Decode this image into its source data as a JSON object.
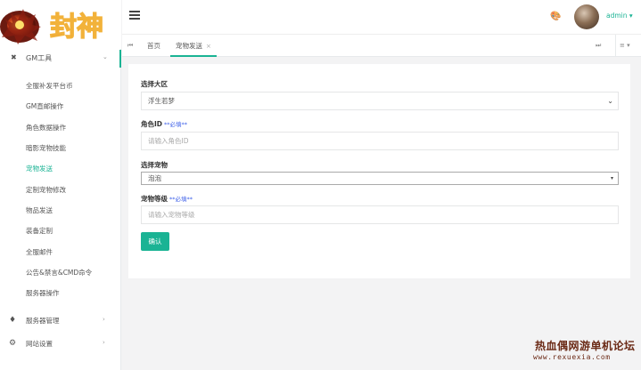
{
  "colors": {
    "accent": "#1ab394",
    "required": "#3b5ee8"
  },
  "logo": {
    "text": "封神"
  },
  "sidebar": {
    "group": {
      "label": "GM工具",
      "icon": "wrench-icon"
    },
    "items": [
      {
        "label": "全服补发平台币"
      },
      {
        "label": "GM直邮操作"
      },
      {
        "label": "角色数据操作"
      },
      {
        "label": "暗影宠物技能"
      },
      {
        "label": "宠物发送",
        "active": true
      },
      {
        "label": "定制宠物修改"
      },
      {
        "label": "物品发送"
      },
      {
        "label": "装备定制"
      },
      {
        "label": "全服邮件"
      },
      {
        "label": "公告&禁言&CMD命令"
      },
      {
        "label": "服务器操作"
      }
    ],
    "bottom": [
      {
        "label": "服务器管理",
        "icon": "diamond-icon"
      },
      {
        "label": "网站设置",
        "icon": "gear-icon"
      }
    ]
  },
  "topbar": {
    "user": "admin"
  },
  "tabs": [
    {
      "label": "首页"
    },
    {
      "label": "宠物发送",
      "active": true
    }
  ],
  "form": {
    "zone": {
      "label": "选择大区",
      "value": "浮生若梦"
    },
    "role_id": {
      "label": "角色ID",
      "required": "**必填**",
      "placeholder": "请输入角色ID"
    },
    "pet": {
      "label": "选择宠物",
      "value": "泡泡"
    },
    "pet_level": {
      "label": "宠物等级",
      "required": "**必填**",
      "placeholder": "请输入宠物等级"
    },
    "submit": "确认"
  },
  "watermark": {
    "title": "热血偶网游单机论坛",
    "url": "www.rexuexia.com"
  }
}
